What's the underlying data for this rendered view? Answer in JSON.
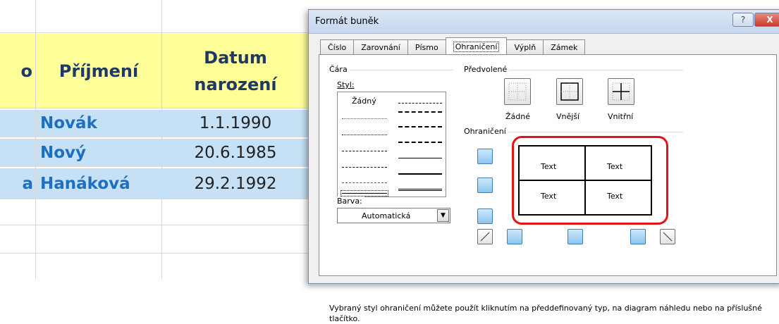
{
  "sheet": {
    "headers": {
      "col_a_partial": "o",
      "surname": "Příjmení",
      "birthdate": "Datum narození"
    },
    "rows": [
      {
        "prefix": "",
        "surname": "Novák",
        "birthdate": "1.1.1990"
      },
      {
        "prefix": "",
        "surname": "Nový",
        "birthdate": "20.6.1985"
      },
      {
        "prefix": "a",
        "surname": "Hanáková",
        "birthdate": "29.2.1992"
      }
    ]
  },
  "dialog": {
    "title": "Formát buněk",
    "help_label": "?",
    "close_label": "X",
    "tabs": [
      {
        "label": "Číslo",
        "active": false
      },
      {
        "label": "Zarovnání",
        "active": false
      },
      {
        "label": "Písmo",
        "active": false
      },
      {
        "label": "Ohraničení",
        "active": true
      },
      {
        "label": "Výplň",
        "active": false
      },
      {
        "label": "Zámek",
        "active": false
      }
    ],
    "line_group_label": "Čára",
    "style_label": "Styl:",
    "none_style_label": "Žádný",
    "color_label": "Barva:",
    "color_value": "Automatická",
    "presets_label": "Předvolené",
    "presets": [
      {
        "label": "Žádné"
      },
      {
        "label": "Vnější"
      },
      {
        "label": "Vnitřní"
      }
    ],
    "border_group_label": "Ohraničení",
    "preview_cells": [
      "Text",
      "Text",
      "Text",
      "Text"
    ],
    "hint": "Vybraný styl ohraničení můžete použít kliknutím na předdefinovaný typ, na diagram náhledu nebo na příslušné tlačítko."
  },
  "colors": {
    "header_fill": "#ffff99",
    "row_fill": "#c6e0f5",
    "highlight": "#e0151a"
  }
}
